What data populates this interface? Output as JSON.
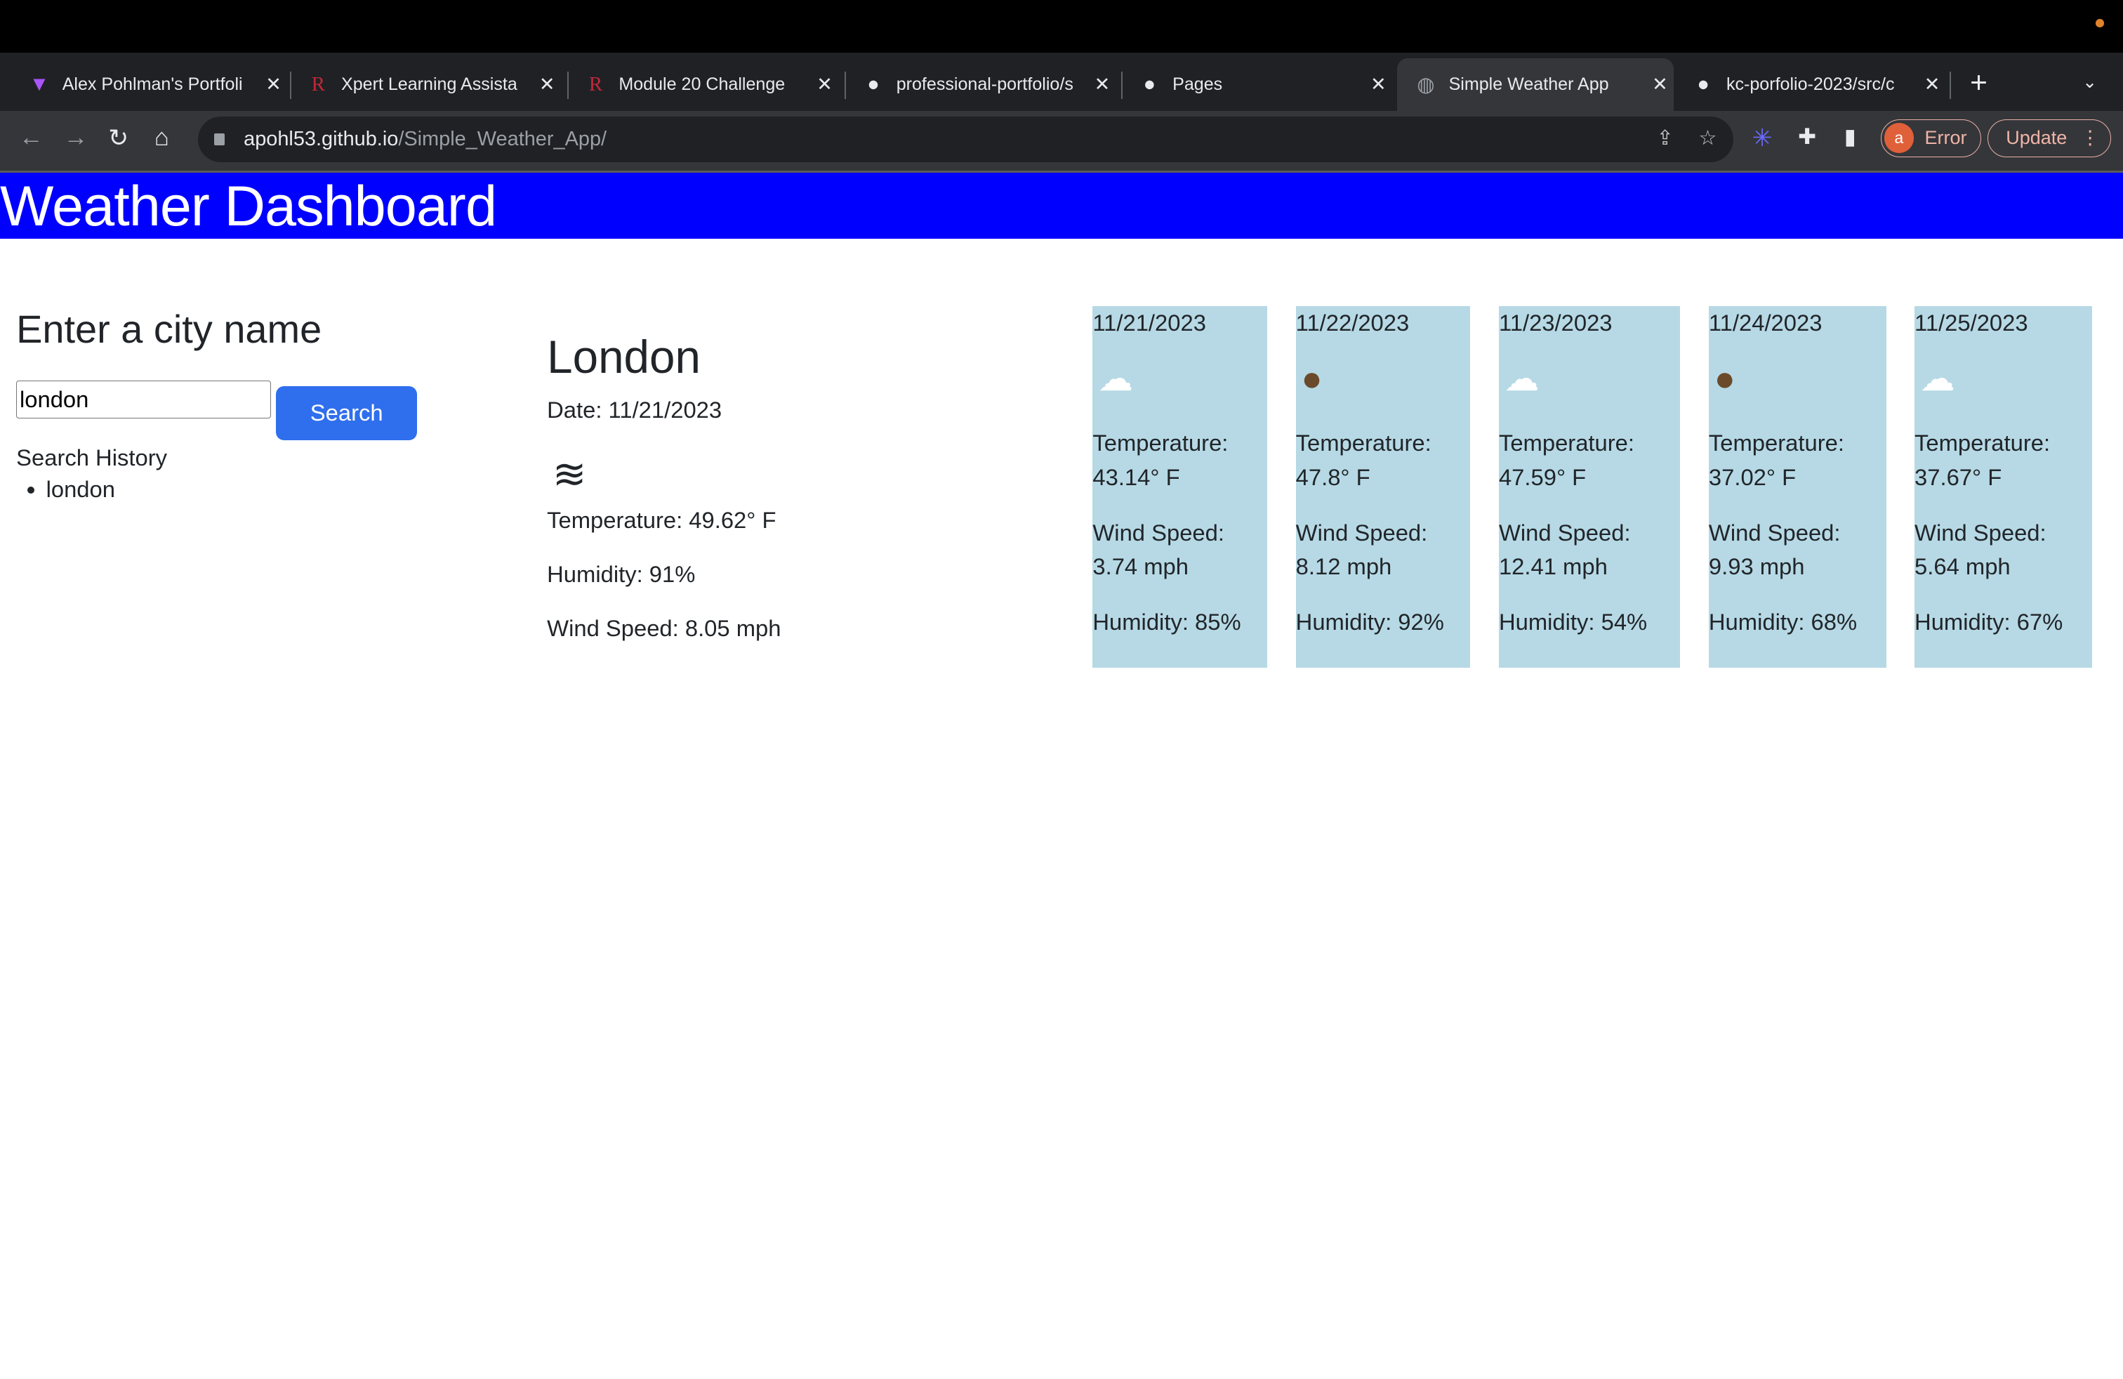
{
  "browser": {
    "tabs": [
      {
        "title": "Alex Pohlman's Portfoli",
        "icon": "vite-icon"
      },
      {
        "title": "Xpert Learning Assista",
        "icon": "r-logo-icon"
      },
      {
        "title": "Module 20 Challenge",
        "icon": "r-logo-icon"
      },
      {
        "title": "professional-portfolio/s",
        "icon": "github-icon"
      },
      {
        "title": "Pages",
        "icon": "github-icon"
      },
      {
        "title": "Simple Weather App",
        "icon": "globe-icon",
        "active": true
      },
      {
        "title": "kc-porfolio-2023/src/c",
        "icon": "github-icon"
      }
    ],
    "url_host": "apohl53.github.io",
    "url_path": "/Simple_Weather_App/",
    "profile_initial": "a",
    "error_label": "Error",
    "update_label": "Update"
  },
  "header": {
    "title": "Weather Dashboard"
  },
  "search": {
    "heading": "Enter a city name",
    "input_value": "london",
    "button_label": "Search",
    "history_label": "Search History",
    "history": [
      "london"
    ]
  },
  "current": {
    "city": "London",
    "date": "Date: 11/21/2023",
    "icon": "mist-icon",
    "temperature": "Temperature: 49.62° F",
    "humidity": "Humidity: 91%",
    "wind": "Wind Speed: 8.05 mph"
  },
  "forecast": [
    {
      "date": "11/21/2023",
      "icon": "cloud-icon",
      "temp_label": "Temperature:",
      "temp": "43.14° F",
      "wind_label": "Wind Speed:",
      "wind": "3.74 mph",
      "humidity": "Humidity: 85%"
    },
    {
      "date": "11/22/2023",
      "icon": "rain-icon",
      "temp_label": "Temperature:",
      "temp": "47.8° F",
      "wind_label": "Wind Speed:",
      "wind": "8.12 mph",
      "humidity": "Humidity: 92%"
    },
    {
      "date": "11/23/2023",
      "icon": "cloud-icon",
      "temp_label": "Temperature:",
      "temp": "47.59° F",
      "wind_label": "Wind Speed:",
      "wind": "12.41 mph",
      "humidity": "Humidity: 54%"
    },
    {
      "date": "11/24/2023",
      "icon": "rain-icon",
      "temp_label": "Temperature:",
      "temp": "37.02° F",
      "wind_label": "Wind Speed:",
      "wind": "9.93 mph",
      "humidity": "Humidity: 68%"
    },
    {
      "date": "11/25/2023",
      "icon": "cloud-icon",
      "temp_label": "Temperature:",
      "temp": "37.67° F",
      "wind_label": "Wind Speed:",
      "wind": "5.64 mph",
      "humidity": "Humidity: 67%"
    }
  ],
  "colors": {
    "header_bg": "#0000ff",
    "card_bg": "#b6d9e5",
    "button_bg": "#2f6fed"
  }
}
